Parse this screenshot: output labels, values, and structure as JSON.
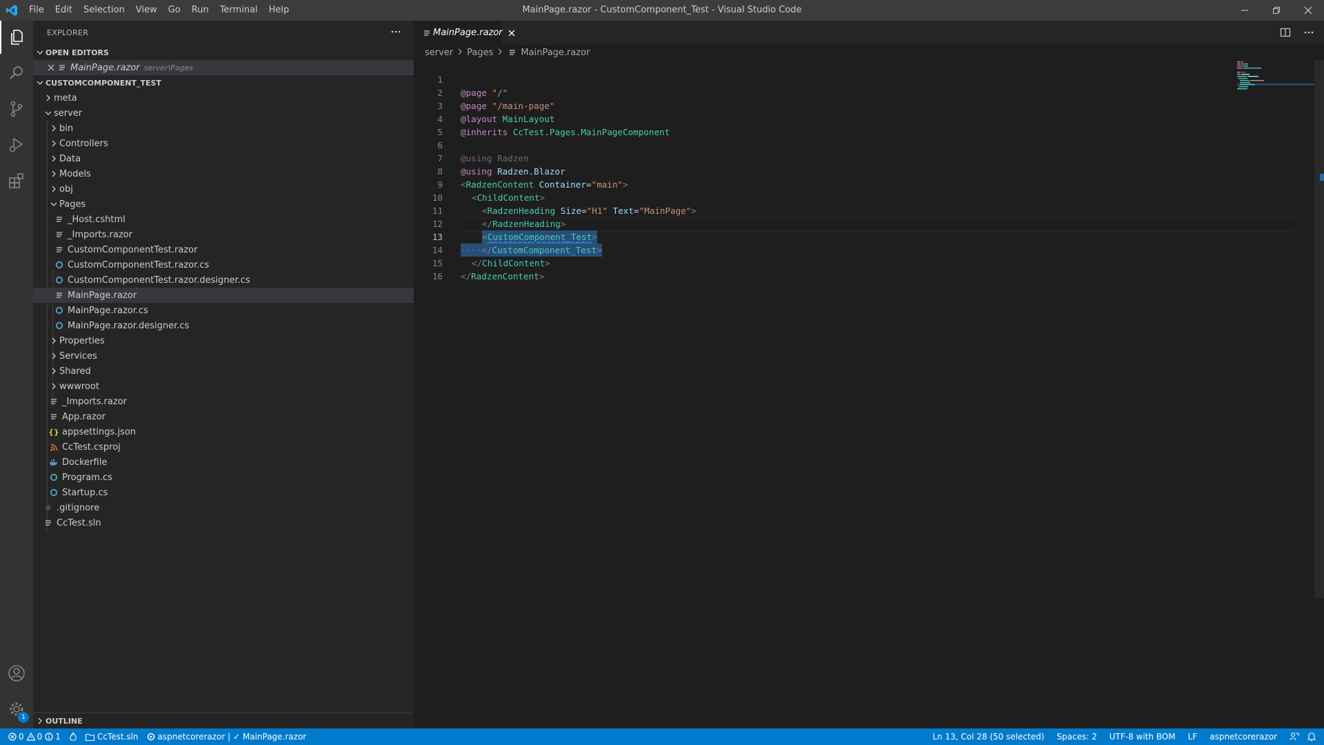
{
  "titlebar": {
    "menus": [
      "File",
      "Edit",
      "Selection",
      "View",
      "Go",
      "Run",
      "Terminal",
      "Help"
    ],
    "window_title": "MainPage.razor - CustomComponent_Test - Visual Studio Code"
  },
  "activity_bar": {
    "icons": [
      "explorer-icon",
      "search-icon",
      "source-control-icon",
      "run-debug-icon",
      "extensions-icon",
      "accounts-icon",
      "manage-gear-icon"
    ],
    "manage_badge": "1"
  },
  "sidebar": {
    "title": "EXPLORER",
    "open_editors": {
      "label": "OPEN EDITORS",
      "items": [
        {
          "name": "MainPage.razor",
          "path": "server\\Pages"
        }
      ]
    },
    "workspace": {
      "label": "CUSTOMCOMPONENT_TEST",
      "tree": {
        "meta": "meta",
        "server": "server",
        "bin": "bin",
        "controllers": "Controllers",
        "data": "Data",
        "models": "Models",
        "obj": "obj",
        "pages": "Pages",
        "host": "_Host.cshtml",
        "pages_imports": "_Imports.razor",
        "cct_razor": "CustomComponentTest.razor",
        "cct_cs": "CustomComponentTest.razor.cs",
        "cct_designer": "CustomComponentTest.razor.designer.cs",
        "mainpage": "MainPage.razor",
        "mainpage_cs": "MainPage.razor.cs",
        "mainpage_designer": "MainPage.razor.designer.cs",
        "properties": "Properties",
        "services": "Services",
        "shared": "Shared",
        "wwwroot": "wwwroot",
        "server_imports": "_Imports.razor",
        "app": "App.razor",
        "appsettings": "appsettings.json",
        "csproj": "CcTest.csproj",
        "dockerfile": "Dockerfile",
        "program": "Program.cs",
        "startup": "Startup.cs",
        "gitignore": ".gitignore",
        "sln": "CcTest.sln"
      }
    },
    "outline_label": "OUTLINE"
  },
  "editor": {
    "tab_label": "MainPage.razor",
    "breadcrumb": [
      "server",
      "Pages",
      "MainPage.razor"
    ],
    "line_numbers": [
      "1",
      "2",
      "3",
      "4",
      "5",
      "6",
      "7",
      "8",
      "9",
      "10",
      "11",
      "12",
      "13",
      "14",
      "15",
      "16"
    ],
    "code": {
      "l1_kw": "@page",
      "l1_str": "\"/\"",
      "l2_kw": "@page",
      "l2_str": "\"/main-page\"",
      "l3_kw": "@layout",
      "l3_type": "MainLayout",
      "l4_kw": "@inherits",
      "l4_ns": "CcTest.Pages.",
      "l4_type": "MainPageComponent",
      "l6_kw": "@using",
      "l6_ns": "Radzen",
      "l7_kw": "@using",
      "l7_ns": "Radzen.Blazor",
      "l8_open": "<",
      "l8_tag": "RadzenContent",
      "l8_attr": "Container",
      "l8_eq": "=",
      "l8_val": "\"main\"",
      "l8_close": ">",
      "l9_open": "<",
      "l9_tag": "ChildContent",
      "l9_close": ">",
      "l10_open": "<",
      "l10_tag": "RadzenHeading",
      "l10_attr1": "Size",
      "l10_eq1": "=",
      "l10_val1": "\"H1\"",
      "l10_attr2": "Text",
      "l10_eq2": "=",
      "l10_val2": "\"MainPage\"",
      "l10_close": ">",
      "l11_open": "</",
      "l11_tag": "RadzenHeading",
      "l11_close": ">",
      "l12_open": "<",
      "l12_tag": "CustomComponent_Test",
      "l12_close": ">",
      "l13_ws": "····",
      "l13_open": "</",
      "l13_tag": "CustomComponent_Test",
      "l13_close": ">",
      "l14_open": "</",
      "l14_tag": "ChildContent",
      "l14_close": ">",
      "l15_open": "</",
      "l15_tag": "RadzenContent",
      "l15_close": ">"
    }
  },
  "statusbar": {
    "errors": "0",
    "warnings": "0",
    "info": "1",
    "solution": "CcTest.sln",
    "project": "aspnetcorerazor | ✓ MainPage.razor",
    "position": "Ln 13, Col 28 (50 selected)",
    "spaces": "Spaces: 2",
    "encoding": "UTF-8 with BOM",
    "eol": "LF",
    "language": "aspnetcorerazor"
  },
  "colors": {
    "accent": "#007acc",
    "titlebar": "#3c3c3c",
    "activitybar": "#333333",
    "sidebar": "#252526",
    "editor": "#1e1e1e",
    "selection": "#264f78"
  }
}
